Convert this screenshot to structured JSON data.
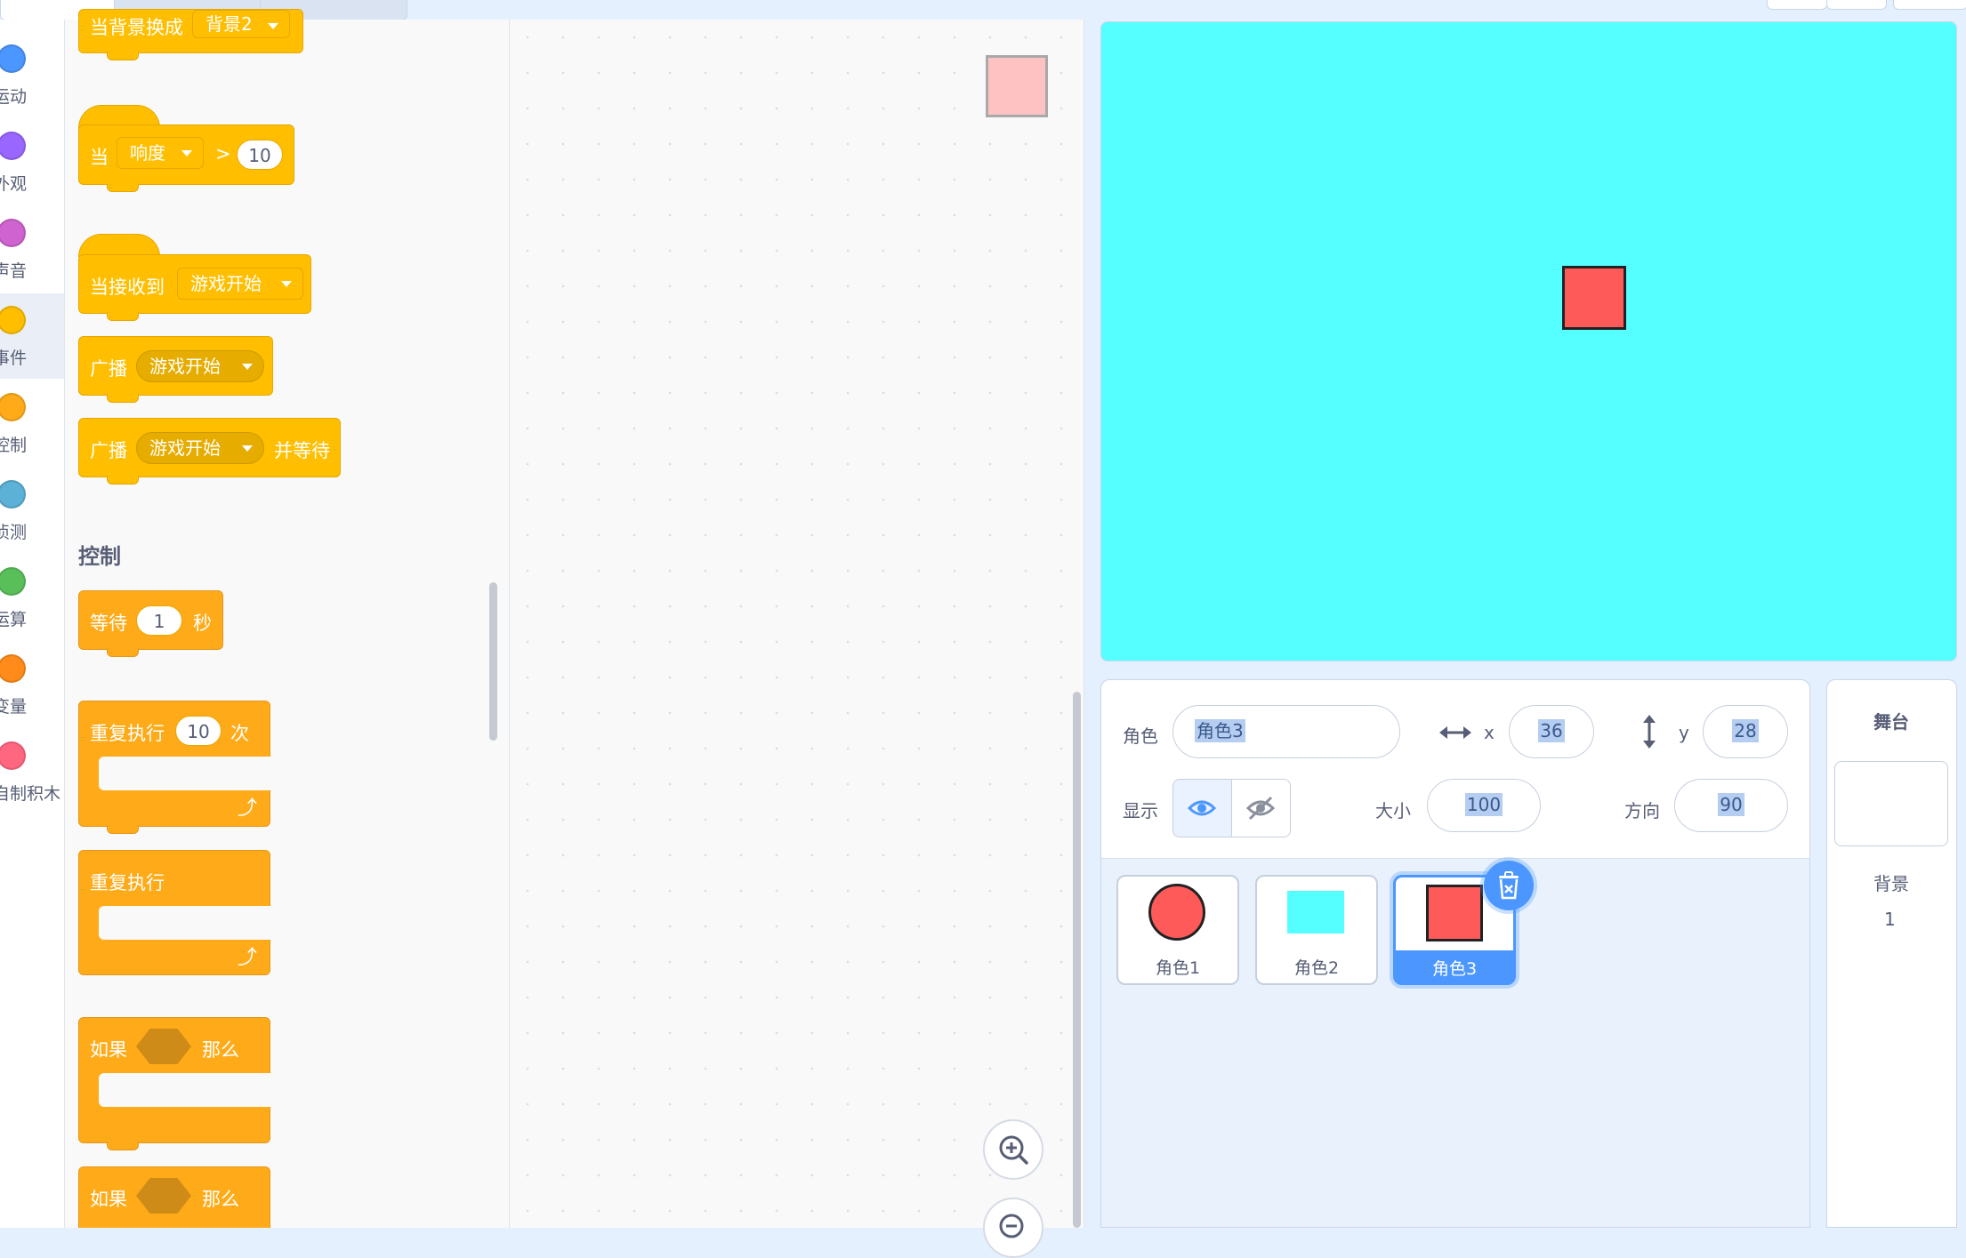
{
  "categories": [
    {
      "label": "运动",
      "color": "#4c97ff"
    },
    {
      "label": "外观",
      "color": "#9966ff"
    },
    {
      "label": "声音",
      "color": "#cf63cf"
    },
    {
      "label": "事件",
      "color": "#ffbf00"
    },
    {
      "label": "控制",
      "color": "#ffab19"
    },
    {
      "label": "侦测",
      "color": "#5cb1d6"
    },
    {
      "label": "运算",
      "color": "#59c059"
    },
    {
      "label": "变量",
      "color": "#ff8c1a"
    },
    {
      "label": "自制积木",
      "color": "#ff6680"
    }
  ],
  "palette": {
    "backdrop_block": {
      "text": "当背景换成",
      "value": "背景2"
    },
    "loudness_block": {
      "text": "当",
      "dropdown": "响度",
      "op": ">",
      "value": "10"
    },
    "receive_block": {
      "text": "当接收到",
      "dropdown": "游戏开始"
    },
    "broadcast_block": {
      "text": "广播",
      "dropdown": "游戏开始"
    },
    "broadcast_wait_block": {
      "text": "广播",
      "dropdown": "游戏开始",
      "suffix": "并等待"
    },
    "control_title": "控制",
    "wait_block": {
      "text": "等待",
      "value": "1",
      "suffix": "秒"
    },
    "repeat_block": {
      "text": "重复执行",
      "value": "10",
      "suffix": "次"
    },
    "forever_block": {
      "text": "重复执行"
    },
    "if_block": {
      "text": "如果",
      "suffix": "那么"
    },
    "if_else_block": {
      "text": "如果",
      "suffix": "那么"
    }
  },
  "sprite_info": {
    "sprite_label": "角色",
    "sprite_name": "角色3",
    "x_label": "x",
    "x_value": "36",
    "y_label": "y",
    "y_value": "28",
    "show_label": "显示",
    "size_label": "大小",
    "size_value": "100",
    "direction_label": "方向",
    "direction_value": "90"
  },
  "sprites": [
    {
      "name": "角色1",
      "shape": "circle",
      "color": "#ff5a5a"
    },
    {
      "name": "角色2",
      "shape": "rect",
      "color": "#56ffff"
    },
    {
      "name": "角色3",
      "shape": "square",
      "color": "#ff5a5a",
      "selected": true
    }
  ],
  "stage_panel": {
    "title": "舞台",
    "backdrop_label": "背景",
    "backdrop_count": "1"
  },
  "colors": {
    "stage_background": "#56ffff",
    "events": "#ffbf00",
    "control": "#ffab19",
    "selection": "#4c97ff"
  }
}
